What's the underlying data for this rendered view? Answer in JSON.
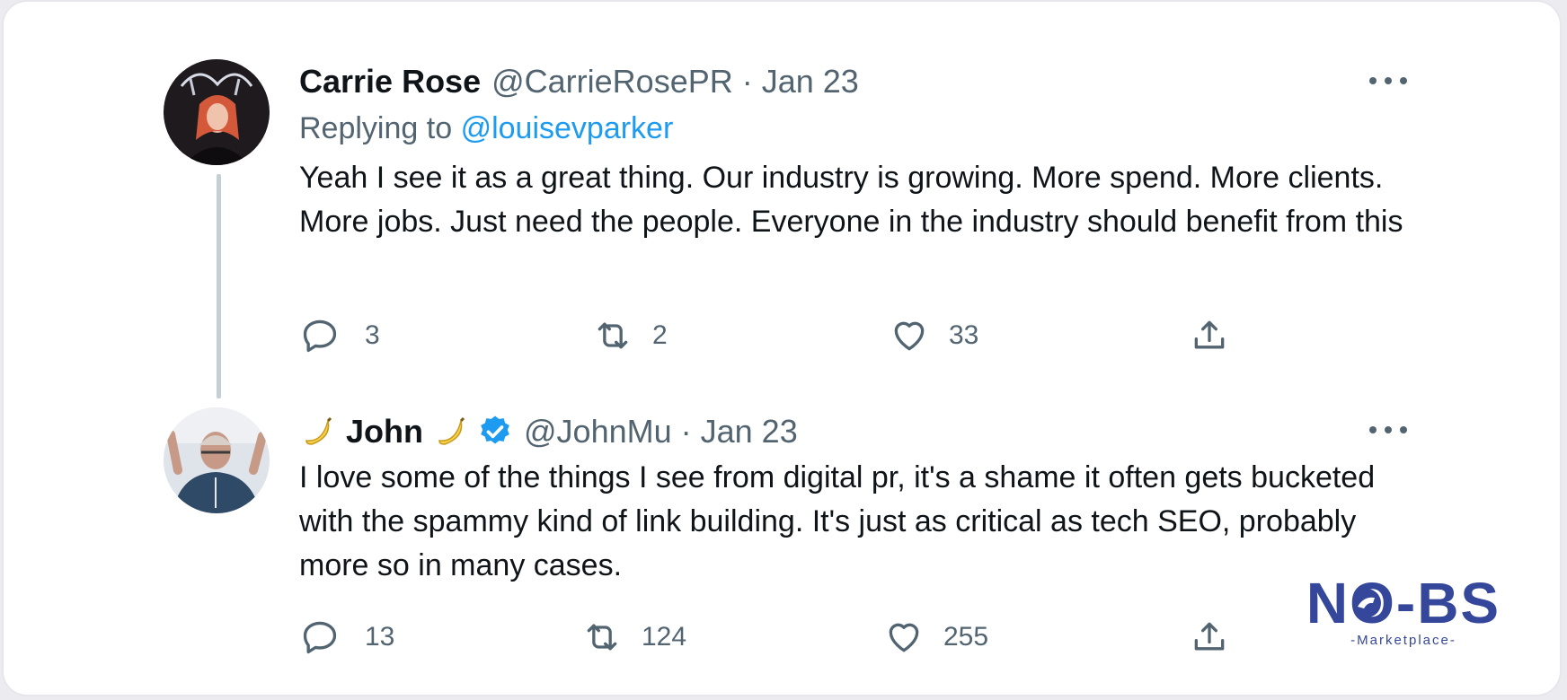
{
  "tweets": [
    {
      "name": "Carrie Rose",
      "handle": "@CarrieRosePR",
      "separator": "·",
      "date": "Jan 23",
      "replying_prefix": "Replying to",
      "replying_to": "@louisevparker",
      "text": "Yeah I see it as a great thing. Our industry is growing. More spend. More clients. More jobs. Just need the people. Everyone in the industry should benefit from this",
      "replies": "3",
      "retweets": "2",
      "likes": "33"
    },
    {
      "name": "John",
      "name_emoji": "banana-icon",
      "verified": true,
      "handle": "@JohnMu",
      "separator": "·",
      "date": "Jan 23",
      "text": "I love some of the things I see from digital pr, it's a shame it often gets bucketed with the spammy kind of link building. It's just as critical as tech SEO, probably more so in many cases.",
      "replies": "13",
      "retweets": "124",
      "likes": "255"
    }
  ],
  "watermark": {
    "brand": "NO-BS",
    "sub": "-Marketplace-",
    "color": "#35479a"
  },
  "colors": {
    "text_primary": "#0f1419",
    "text_secondary": "#536471",
    "link": "#1d9bf0",
    "thread_line": "#c4cfd6"
  },
  "icons": [
    "reply-icon",
    "retweet-icon",
    "like-icon",
    "share-icon",
    "more-icon",
    "verified-badge-icon",
    "banana-icon"
  ]
}
